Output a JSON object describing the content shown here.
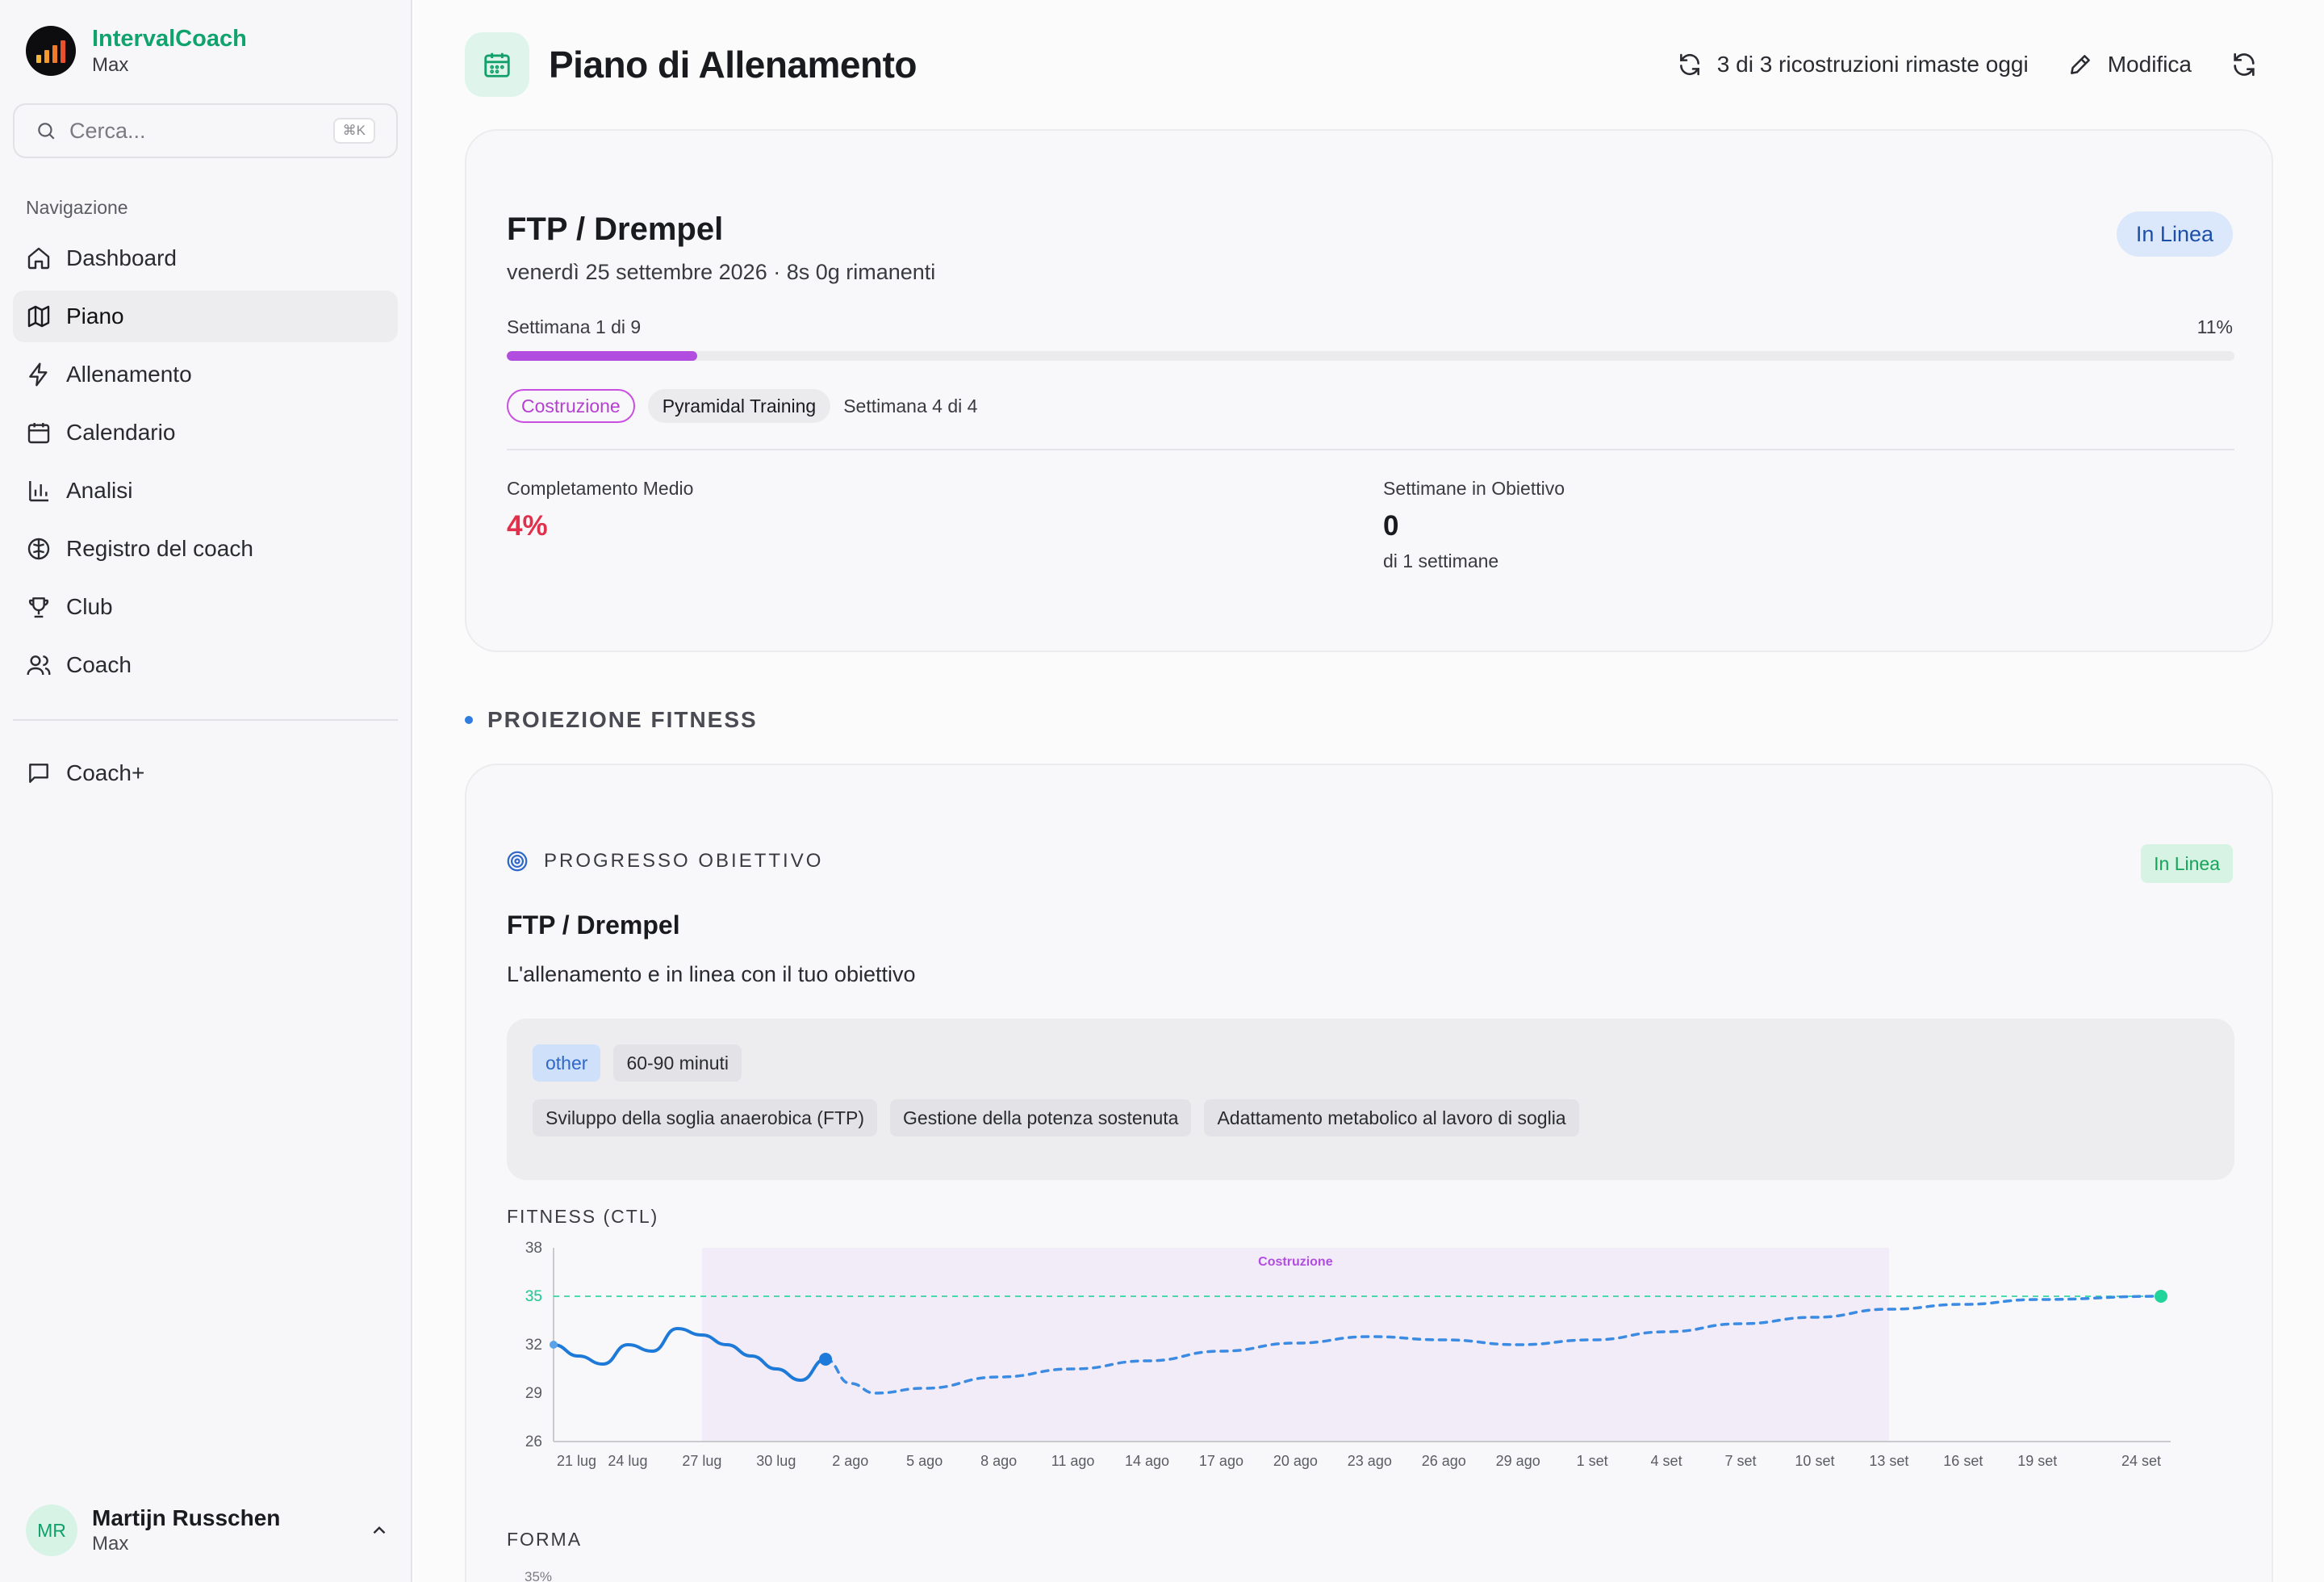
{
  "app": {
    "name": "IntervalCoach",
    "subtitle": "Max"
  },
  "search": {
    "placeholder": "Cerca...",
    "shortcut": "⌘K"
  },
  "nav": {
    "heading": "Navigazione",
    "items": [
      {
        "label": "Dashboard",
        "icon": "home-icon",
        "active": false
      },
      {
        "label": "Piano",
        "icon": "map-icon",
        "active": true
      },
      {
        "label": "Allenamento",
        "icon": "bolt-icon",
        "active": false
      },
      {
        "label": "Calendario",
        "icon": "calendar-icon",
        "active": false
      },
      {
        "label": "Analisi",
        "icon": "bar-chart-icon",
        "active": false
      },
      {
        "label": "Registro del coach",
        "icon": "brain-icon",
        "active": false
      },
      {
        "label": "Club",
        "icon": "trophy-icon",
        "active": false
      },
      {
        "label": "Coach",
        "icon": "users-icon",
        "active": false
      }
    ],
    "secondary": [
      {
        "label": "Coach+",
        "icon": "chat-icon"
      }
    ]
  },
  "user": {
    "initials": "MR",
    "name": "Martijn Russchen",
    "plan": "Max"
  },
  "header": {
    "title": "Piano di Allenamento",
    "rebuilds": "3 di 3 ricostruzioni rimaste oggi",
    "edit": "Modifica"
  },
  "plan": {
    "goal_title": "FTP / Drempel",
    "date_line": "venerdì 25 settembre 2026 · 8s 0g rimanenti",
    "status": "In Linea",
    "week_label": "Settimana 1 di 9",
    "week_pct_label": "11%",
    "progress": 0.11,
    "phase": "Costruzione",
    "block": "Pyramidal Training",
    "block_week": "Settimana 4 di 4",
    "stats": {
      "completion_label": "Completamento Medio",
      "completion_value": "4%",
      "weeks_label": "Settimane in Obiettivo",
      "weeks_value": "0",
      "weeks_sub": "di 1 settimane"
    }
  },
  "projection": {
    "section_title": "PROIEZIONE FITNESS",
    "heading": "PROGRESSO OBIETTIVO",
    "status": "In Linea",
    "goal_title": "FTP / Drempel",
    "description": "L'allenamento e in linea con il tuo obiettivo",
    "tags": [
      "other",
      "60-90 minuti"
    ],
    "focus": [
      "Sviluppo della soglia anaerobica (FTP)",
      "Gestione della potenza sostenuta",
      "Adattamento metabolico al lavoro di soglia"
    ],
    "chart_title": "FITNESS (CTL)",
    "chart2_title": "FORMA",
    "chart2_first_tick": "35%"
  },
  "colors": {
    "brand": "#10a36e",
    "accent_purple": "#b14ddf",
    "status_blue": "#1d4fa8",
    "status_green": "#17a45a",
    "danger": "#e0304b",
    "line_blue": "#1e7ad9",
    "target": "#22d39a"
  },
  "chart_data": {
    "type": "line",
    "title": "FITNESS (CTL)",
    "xlabel": "",
    "ylabel": "",
    "ylim": [
      26,
      38
    ],
    "y_ticks": [
      38,
      35,
      32,
      29,
      26
    ],
    "x_ticks": [
      "21 lug",
      "24 lug",
      "27 lug",
      "30 lug",
      "2 ago",
      "5 ago",
      "8 ago",
      "11 ago",
      "14 ago",
      "17 ago",
      "20 ago",
      "23 ago",
      "26 ago",
      "29 ago",
      "1 set",
      "4 set",
      "7 set",
      "10 set",
      "13 set",
      "16 set",
      "19 set",
      "24 set"
    ],
    "target": {
      "value": 35,
      "label": "35"
    },
    "phase_band": {
      "label": "Costruzione",
      "start": "27 lug",
      "end": "13 set"
    },
    "grid": false,
    "series": [
      {
        "style": "solid",
        "x": [
          "21 lug",
          "22 lug",
          "23 lug",
          "24 lug",
          "25 lug",
          "26 lug",
          "27 lug",
          "28 lug",
          "29 lug",
          "30 lug",
          "31 lug",
          "1 ago"
        ],
        "values": [
          32.0,
          31.3,
          30.8,
          32.0,
          31.6,
          33.0,
          32.6,
          32.0,
          31.3,
          30.5,
          29.8,
          31.1
        ]
      },
      {
        "style": "dashed",
        "x": [
          "1 ago",
          "2 ago",
          "3 ago",
          "5 ago",
          "8 ago",
          "11 ago",
          "14 ago",
          "17 ago",
          "20 ago",
          "23 ago",
          "26 ago",
          "29 ago",
          "1 set",
          "4 set",
          "7 set",
          "10 set",
          "13 set",
          "16 set",
          "19 set",
          "24 set"
        ],
        "values": [
          31.1,
          29.6,
          29.0,
          29.3,
          30.0,
          30.5,
          31.0,
          31.6,
          32.1,
          32.5,
          32.3,
          32.0,
          32.3,
          32.8,
          33.3,
          33.7,
          34.2,
          34.5,
          34.8,
          35.0
        ]
      }
    ]
  }
}
